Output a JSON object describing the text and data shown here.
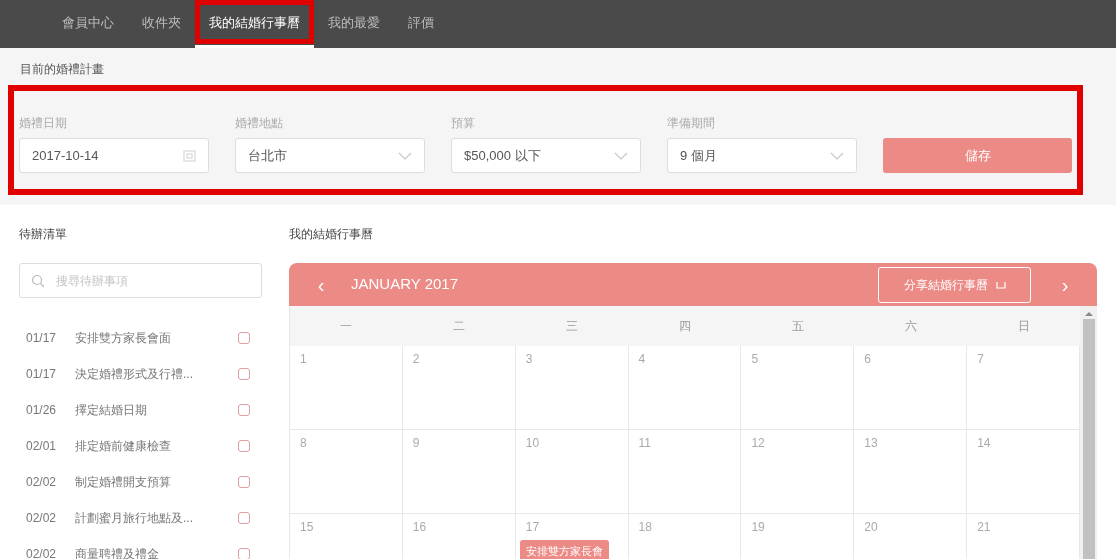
{
  "nav": {
    "tabs": [
      {
        "label": "會員中心",
        "selected": false
      },
      {
        "label": "收件夾",
        "selected": false
      },
      {
        "label": "我的結婚行事曆",
        "selected": true,
        "highlighted": true
      },
      {
        "label": "我的最愛",
        "selected": false
      },
      {
        "label": "評價",
        "selected": false
      }
    ]
  },
  "plan": {
    "title": "目前的婚禮計畫",
    "highlighted": true,
    "fields": [
      {
        "kind": "date",
        "label": "婚禮日期",
        "value": "2017-10-14"
      },
      {
        "kind": "select",
        "label": "婚禮地點",
        "value": "台北市"
      },
      {
        "kind": "select",
        "label": "預算",
        "value": "$50,000 以下"
      },
      {
        "kind": "select",
        "label": "準備期間",
        "value": "9 個月"
      }
    ],
    "save_button": "儲存"
  },
  "todo": {
    "title": "待辦清單",
    "search": {
      "placeholder": "搜尋待辦事項"
    },
    "items": [
      {
        "date": "01/17",
        "text": "安排雙方家長會面",
        "checked": false
      },
      {
        "date": "01/17",
        "text": "決定婚禮形式及行禮...",
        "checked": false
      },
      {
        "date": "01/26",
        "text": "擇定結婚日期",
        "checked": false
      },
      {
        "date": "02/01",
        "text": "排定婚前健康檢查",
        "checked": false
      },
      {
        "date": "02/02",
        "text": "制定婚禮開支預算",
        "checked": false
      },
      {
        "date": "02/02",
        "text": "計劃蜜月旅行地點及...",
        "checked": false
      },
      {
        "date": "02/02",
        "text": "商量聘禮及禮金",
        "checked": false
      }
    ]
  },
  "calendar": {
    "title": "我的結婚行事曆",
    "month": "JANUARY 2017",
    "prev": "‹",
    "next": "›",
    "share_button": "分享結婚行事曆",
    "weekdays": [
      "一",
      "二",
      "三",
      "四",
      "五",
      "六",
      "日"
    ],
    "weeks": [
      [
        {
          "day": "1"
        },
        {
          "day": "2"
        },
        {
          "day": "3"
        },
        {
          "day": "4"
        },
        {
          "day": "5"
        },
        {
          "day": "6"
        },
        {
          "day": "7"
        }
      ],
      [
        {
          "day": "8"
        },
        {
          "day": "9"
        },
        {
          "day": "10"
        },
        {
          "day": "11"
        },
        {
          "day": "12"
        },
        {
          "day": "13"
        },
        {
          "day": "14"
        }
      ],
      [
        {
          "day": "15"
        },
        {
          "day": "16"
        },
        {
          "day": "17",
          "events": [
            "安排雙方家長會"
          ]
        },
        {
          "day": "18"
        },
        {
          "day": "19"
        },
        {
          "day": "20"
        },
        {
          "day": "21"
        }
      ]
    ]
  }
}
